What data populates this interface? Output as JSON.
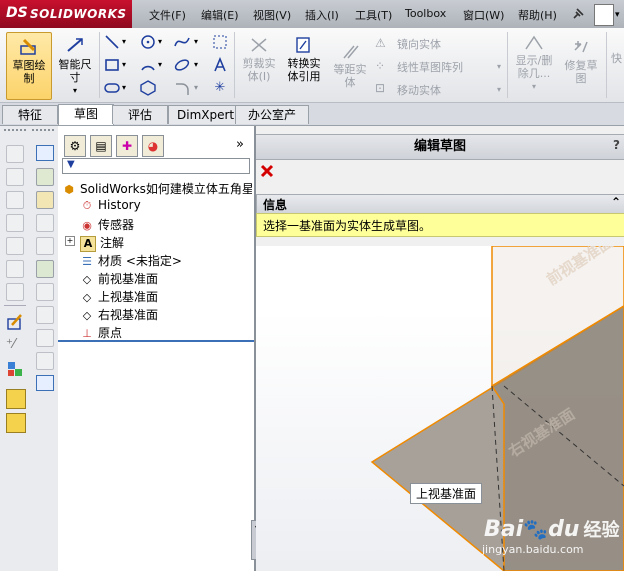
{
  "app": {
    "brand_prefix": "DS",
    "brand_name": "SOLIDWORKS"
  },
  "menu": [
    "文件(F)",
    "编辑(E)",
    "视图(V)",
    "插入(I)",
    "工具(T)",
    "Toolbox",
    "窗口(W)",
    "帮助(H)"
  ],
  "ribbon": {
    "sketch": "草图绘制",
    "smart_dim_1": "智能尺",
    "smart_dim_2": "寸",
    "trim_1": "剪裁实",
    "trim_2": "体(I)",
    "convert_1": "转换实",
    "convert_2": "体引用",
    "offset_1": "等距实",
    "offset_2": "体",
    "mirror": "镜向实体",
    "linear_pattern": "线性草图阵列",
    "move": "移动实体",
    "showhide_1": "显示/删",
    "showhide_2": "除几...",
    "repair_1": "修复草",
    "repair_2": "图",
    "quick": "快"
  },
  "tabs": [
    "特征",
    "草图",
    "评估",
    "DimXpert",
    "办公室产品"
  ],
  "active_tab": "草图",
  "tree": {
    "root": "SolidWorks如何建模立体五角星",
    "items": [
      "History",
      "传感器",
      "注解",
      "材质 <未指定>",
      "前视基准面",
      "上视基准面",
      "右视基准面",
      "原点"
    ]
  },
  "property_manager": {
    "title": "编辑草图",
    "help": "?",
    "info_header": "信息",
    "info_text": "选择一基准面为实体生成草图。",
    "collapse_glyph": "«"
  },
  "viewport": {
    "plane_front": "前视基准面",
    "plane_right": "右视基准面",
    "plane_top_tag": "上视基准面",
    "watermark_1": "Bai",
    "watermark_2": "du",
    "watermark_3": "经验",
    "watermark_url": "jingyan.baidu.com"
  },
  "colors": {
    "plane_edge": "#f08a00",
    "plane_fill": "#9a9288",
    "info_bg": "#ffff99",
    "close_red": "#d40000"
  }
}
